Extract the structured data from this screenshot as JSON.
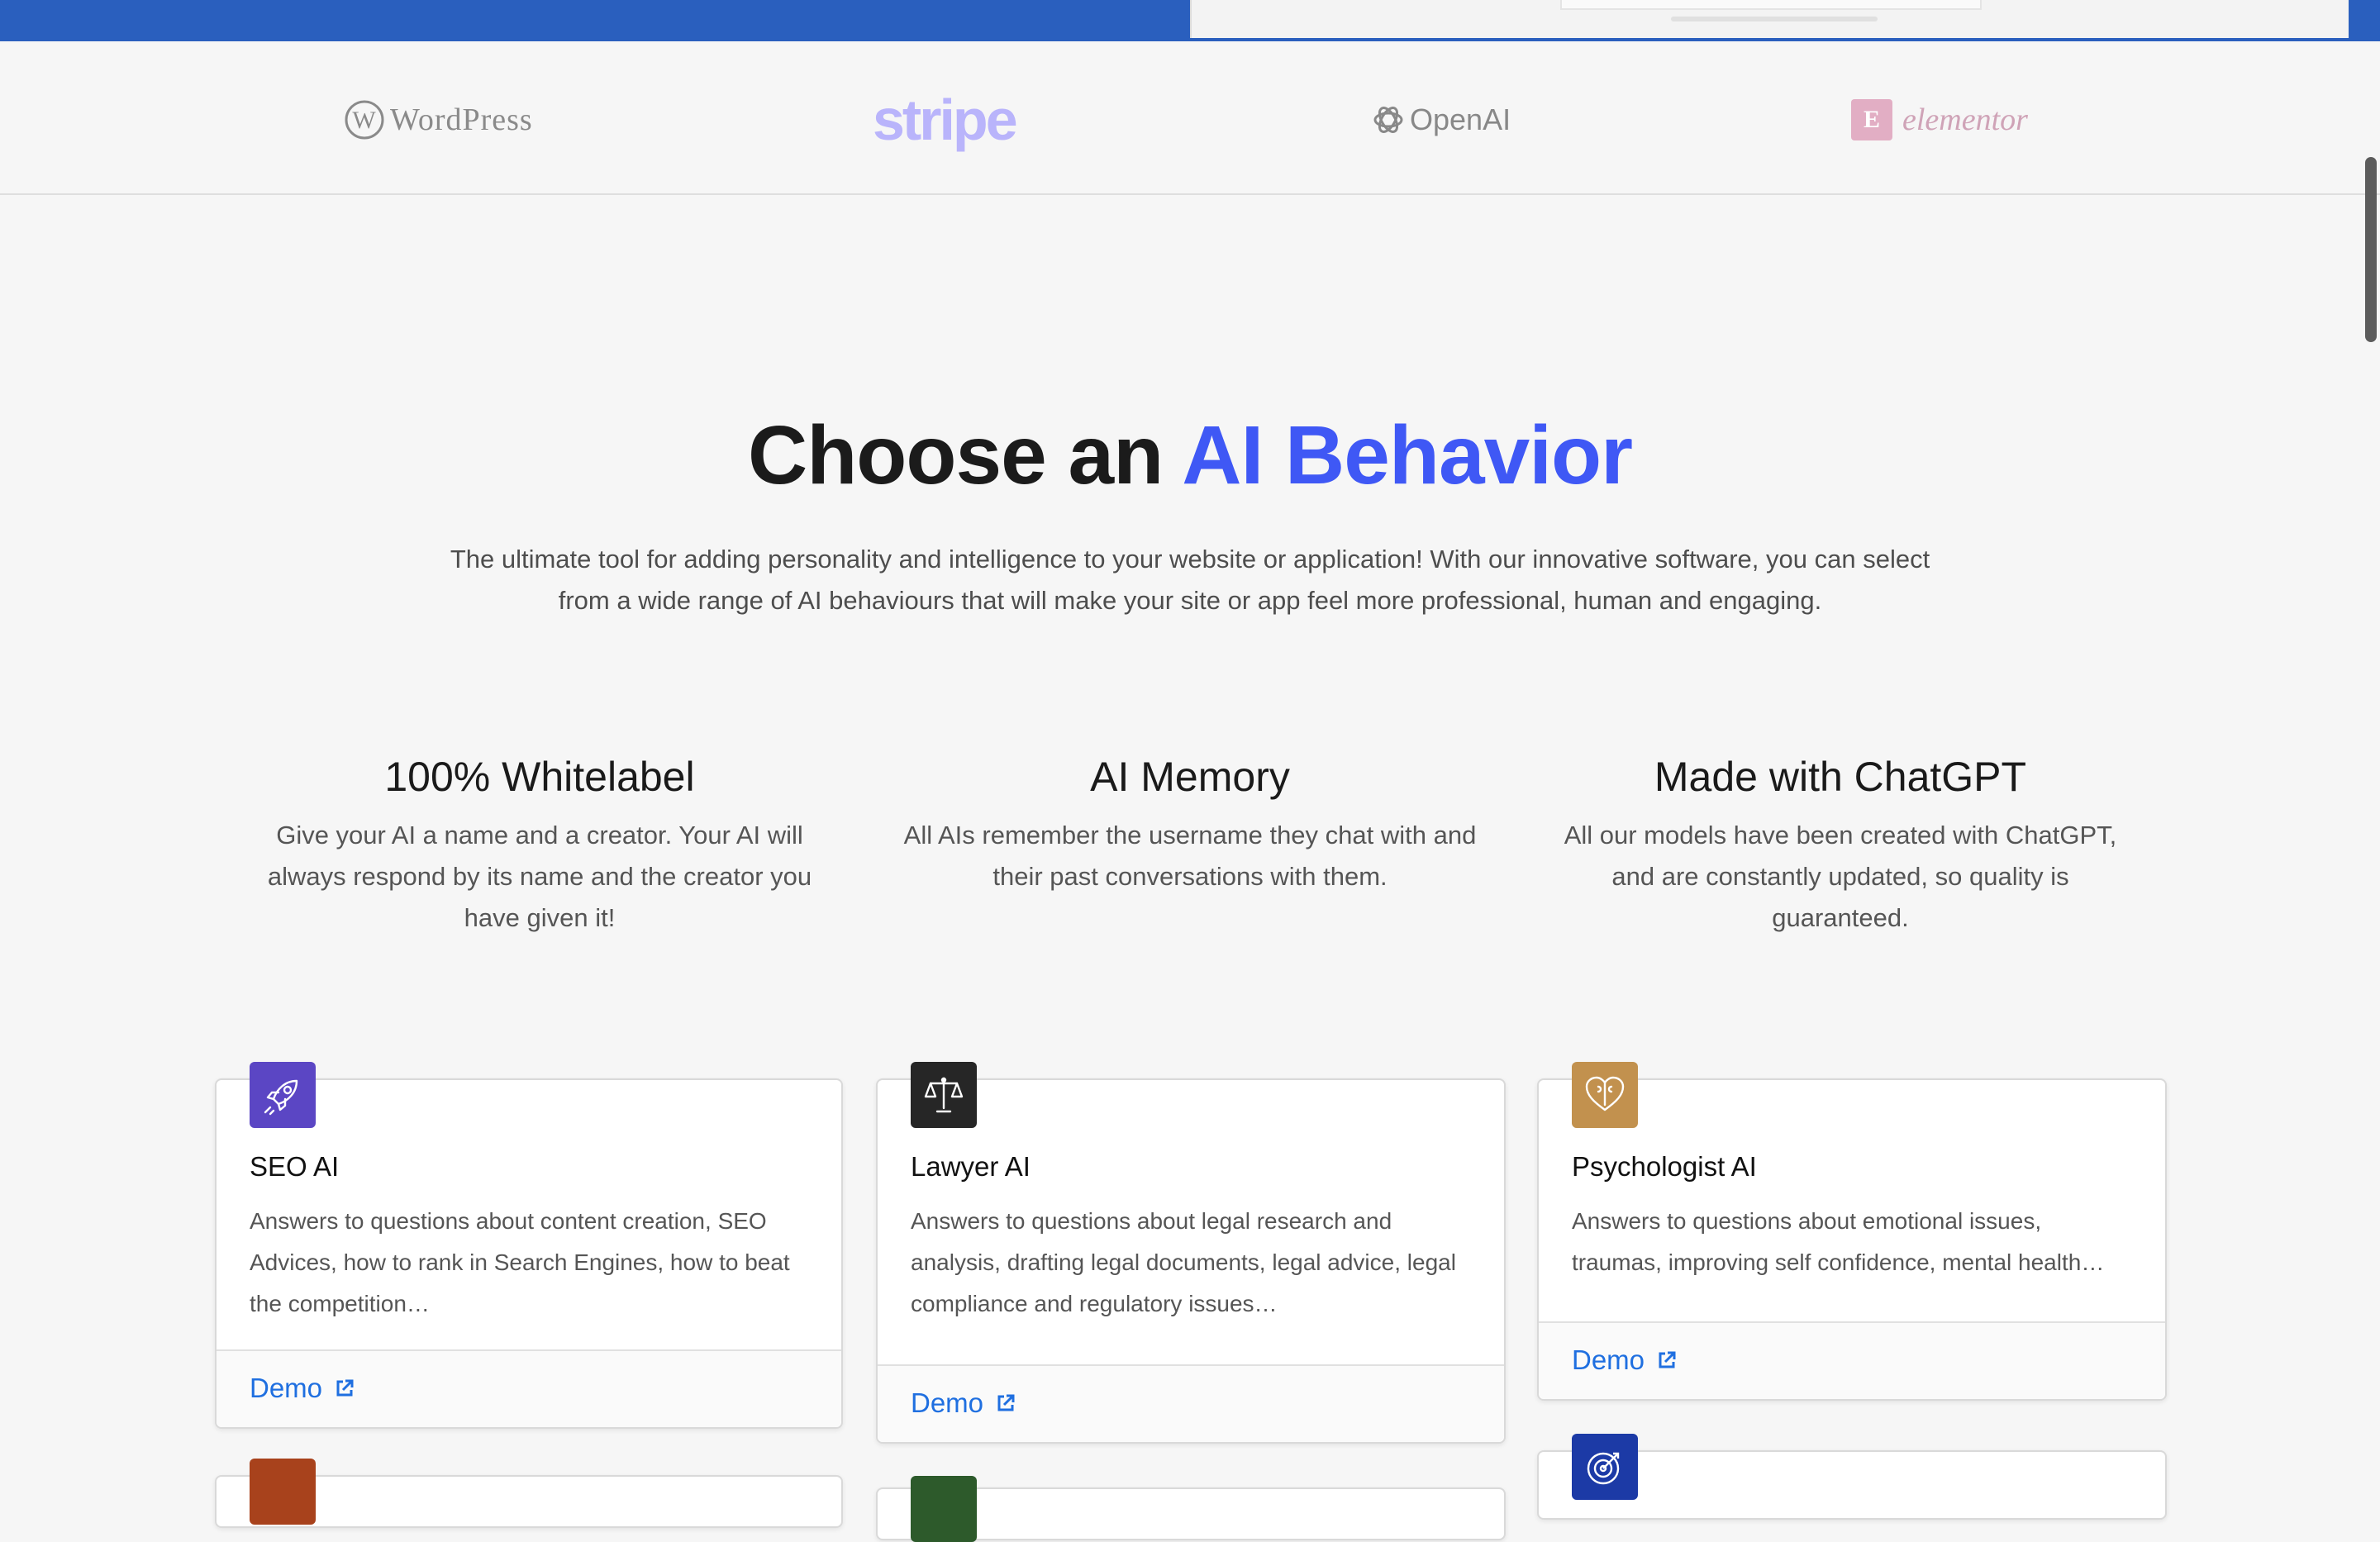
{
  "logos": {
    "wordpress": "WordPress",
    "stripe": "stripe",
    "openai": "OpenAI",
    "elementor": "elementor"
  },
  "hero": {
    "title_prefix": "Choose an ",
    "title_accent": "AI Behavior",
    "subtitle": "The ultimate tool for adding personality and intelligence to your website or application! With our innovative software, you can select from a wide range of AI behaviours that will make your site or app feel more professional, human and engaging."
  },
  "features": [
    {
      "title": "100% Whitelabel",
      "text": "Give your AI a name and a creator. Your AI will always respond by its name and the creator you have given it!"
    },
    {
      "title": "AI Memory",
      "text": "All AIs remember the username they chat with and their past conversations with them."
    },
    {
      "title": "Made with ChatGPT",
      "text": "All our models have been created with ChatGPT, and are constantly updated, so quality is guaranteed."
    }
  ],
  "cards": [
    {
      "title": "SEO AI",
      "desc": "Answers to questions about content creation, SEO Advices, how to rank in Search Engines, how to beat the competition…",
      "demo": "Demo",
      "icon": "rocket-icon",
      "color": "#5b46c4"
    },
    {
      "title": "Lawyer AI",
      "desc": "Answers to questions about legal research and analysis, drafting legal documents, legal advice, legal compliance and regulatory issues…",
      "demo": "Demo",
      "icon": "scales-icon",
      "color": "#262626"
    },
    {
      "title": "Psychologist AI",
      "desc": "Answers to questions about emotional issues, traumas, improving self confidence, mental health…",
      "demo": "Demo",
      "icon": "heart-brain-icon",
      "color": "#c2914e"
    }
  ],
  "colors": {
    "accent": "#3f58f5",
    "link": "#1f6fe0",
    "top_bar": "#2a5fbe"
  }
}
